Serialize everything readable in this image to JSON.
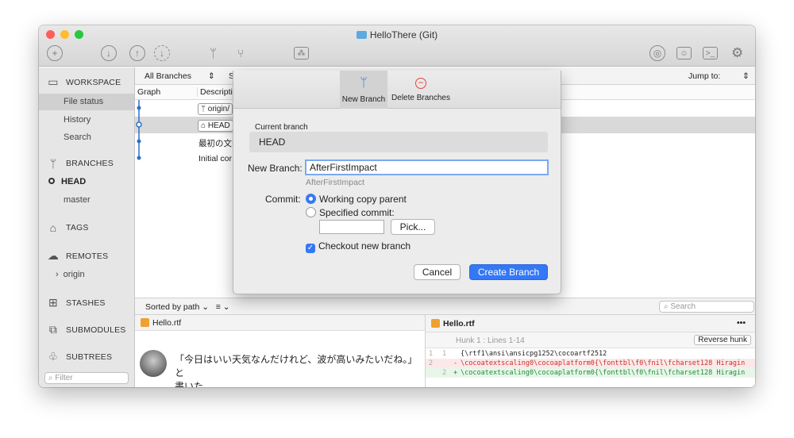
{
  "window": {
    "title": "HelloThere (Git)"
  },
  "toolbar": {
    "icons": [
      "commit-icon",
      "pull-icon",
      "push-icon",
      "fetch-icon",
      "branch-icon",
      "merge-icon",
      "stash-icon",
      "remote-icon",
      "finder-icon",
      "terminal-icon",
      "settings-icon"
    ]
  },
  "sidebar": {
    "workspace": "WORKSPACE",
    "workspace_items": [
      "File status",
      "History",
      "Search"
    ],
    "branches": "BRANCHES",
    "branch_items": [
      "HEAD",
      "master"
    ],
    "tags": "TAGS",
    "remotes": "REMOTES",
    "remote_items": [
      "origin"
    ],
    "stashes": "STASHES",
    "submodules": "SUBMODULES",
    "subtrees": "SUBTREES",
    "filter_placeholder": "Filter"
  },
  "history": {
    "branch_filter": "All Branches",
    "sort_partial": "S",
    "jump_to": "Jump to:",
    "col_graph": "Graph",
    "col_description": "Descriptio",
    "rows": [
      "origin/",
      "HEAD",
      "最初の文書",
      "Initial cor"
    ]
  },
  "bottom": {
    "sorted_by": "Sorted by path",
    "search_placeholder": "Search",
    "file_left": "Hello.rtf",
    "file_right": "Hello.rtf",
    "preview_text_1": "「今日はいい天気なんだけれど、波が高いみたいだね。」と",
    "preview_text_2": "書いた。",
    "hunk_label": "Hunk 1 : Lines 1-14",
    "reverse_hunk": "Reverse hunk",
    "more": "•••",
    "diff_lines": [
      {
        "old": "1",
        "new": "1",
        "sign": " ",
        "text": "{\\rtf1\\ansi\\ansicpg1252\\cocoartf2512"
      },
      {
        "old": "2",
        "new": "",
        "sign": "-",
        "text": "\\cocoatextscaling0\\cocoaplatform0{\\fonttbl\\f0\\fnil\\fcharset128 Hiragin"
      },
      {
        "old": "",
        "new": "2",
        "sign": "+",
        "text": "\\cocoatextscaling0\\cocoaplatform0{\\fonttbl\\f0\\fnil\\fcharset128 Hiragin"
      }
    ]
  },
  "dialog": {
    "tab_new_branch": "New Branch",
    "tab_delete_branches": "Delete Branches",
    "current_branch_label": "Current branch",
    "current_branch_value": "HEAD",
    "new_branch_label": "New Branch:",
    "new_branch_value": "AfterFirstImpact",
    "new_branch_hint": "AfterFirstImpact",
    "commit_label": "Commit:",
    "opt_working_copy": "Working copy parent",
    "opt_specified": "Specified commit:",
    "pick_button": "Pick...",
    "checkout_label": "Checkout new branch",
    "cancel_button": "Cancel",
    "create_button": "Create Branch"
  },
  "colors": {
    "accent": "#3478f6",
    "red": "#e2453c",
    "added": "#1e8c3a",
    "removed": "#c9302c"
  }
}
